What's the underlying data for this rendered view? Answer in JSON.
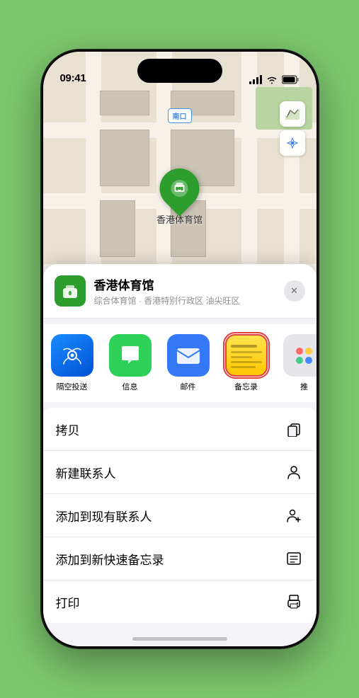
{
  "status": {
    "time": "09:41",
    "location_arrow": "▲"
  },
  "map": {
    "label": "南口"
  },
  "place": {
    "name": "香港体育馆",
    "subtitle": "综合体育馆 · 香港特别行政区 油尖旺区",
    "pin_label": "香港体育馆",
    "close_label": "✕"
  },
  "share_items": [
    {
      "id": "airdrop",
      "label": "隔空投送",
      "type": "airdrop"
    },
    {
      "id": "messages",
      "label": "信息",
      "type": "messages"
    },
    {
      "id": "mail",
      "label": "邮件",
      "type": "mail"
    },
    {
      "id": "notes",
      "label": "备忘录",
      "type": "notes"
    },
    {
      "id": "more",
      "label": "推",
      "type": "more"
    }
  ],
  "actions": [
    {
      "id": "copy",
      "label": "拷贝",
      "icon": "copy"
    },
    {
      "id": "new-contact",
      "label": "新建联系人",
      "icon": "person"
    },
    {
      "id": "add-existing",
      "label": "添加到现有联系人",
      "icon": "person-add"
    },
    {
      "id": "add-notes",
      "label": "添加到新快速备忘录",
      "icon": "notes"
    },
    {
      "id": "print",
      "label": "打印",
      "icon": "printer"
    }
  ]
}
